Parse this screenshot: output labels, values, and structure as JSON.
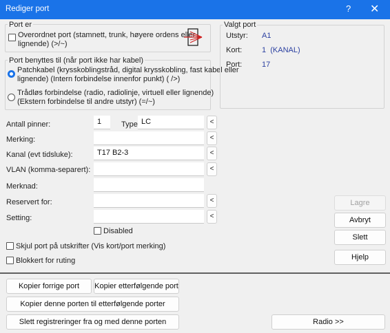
{
  "window": {
    "title": "Rediger port",
    "help": "?",
    "close": "✕"
  },
  "port_er": {
    "group_label": "Port er",
    "overordnet_label_l1": "Overordnet port (stamnett, trunk, høyere ordens eller",
    "overordnet_label_l2": "lignende) (>/~)",
    "overordnet_checked": false
  },
  "benyttes": {
    "group_label": "Port benyttes til (når port ikke har kabel)",
    "patch_l1": "Patchkabel (krysskoblingstråd, digital krysskobling, fast kabel eller",
    "patch_l2": "lignende) (Intern forbindelse innenfor punkt) ( />)",
    "wireless_l1": "Trådløs forbindelse (radio, radiolinje, virtuell eller lignende)",
    "wireless_l2": "(Ekstern forbindelse til andre utstyr) (=/~)",
    "selected": "patch"
  },
  "valgt_port": {
    "group_label": "Valgt port",
    "utstyr_label": "Utstyr:",
    "utstyr_value": "A1",
    "kort_label": "Kort:",
    "kort_value": "1  (KANAL)",
    "port_label": "Port:",
    "port_value": "17"
  },
  "fields": {
    "antall_label": "Antall pinner:",
    "antall_value": "1",
    "type_label": "Type:",
    "type_value": "LC",
    "merking_label": "Merking:",
    "merking_value": "",
    "kanal_label": "Kanal (evt tidsluke):",
    "kanal_value": "T17 B2-3",
    "vlan_label": "VLAN (komma-separert):",
    "vlan_value": "",
    "merknad_label": "Merknad:",
    "merknad_value": "",
    "reservert_label": "Reservert for:",
    "reservert_value": "",
    "setting_label": "Setting:",
    "setting_value": "",
    "disabled_label": "Disabled",
    "disabled_checked": false,
    "skjul_label": "Skjul port på utskrifter (Vis kort/port merking)",
    "skjul_checked": false,
    "blokkert_label": "Blokkert for ruting",
    "blokkert_checked": false,
    "pick_glyph": "<"
  },
  "side_buttons": {
    "lagre": "Lagre",
    "avbryt": "Avbryt",
    "slett": "Slett",
    "hjelp": "Hjelp"
  },
  "bottom_buttons": {
    "kopier_forrige": "Kopier forrige port",
    "kopier_etterfolgende": "Kopier etterfølgende port",
    "kopier_til": "Kopier denne porten til etterfølgende porter",
    "slett_registreringer": "Slett registreringer fra og med denne porten",
    "radio": "Radio >>"
  },
  "colors": {
    "titlebar": "#1a73e8",
    "value_text": "#2a3fa0"
  },
  "icons": {
    "port_symbol": "trunk-port-icon"
  }
}
